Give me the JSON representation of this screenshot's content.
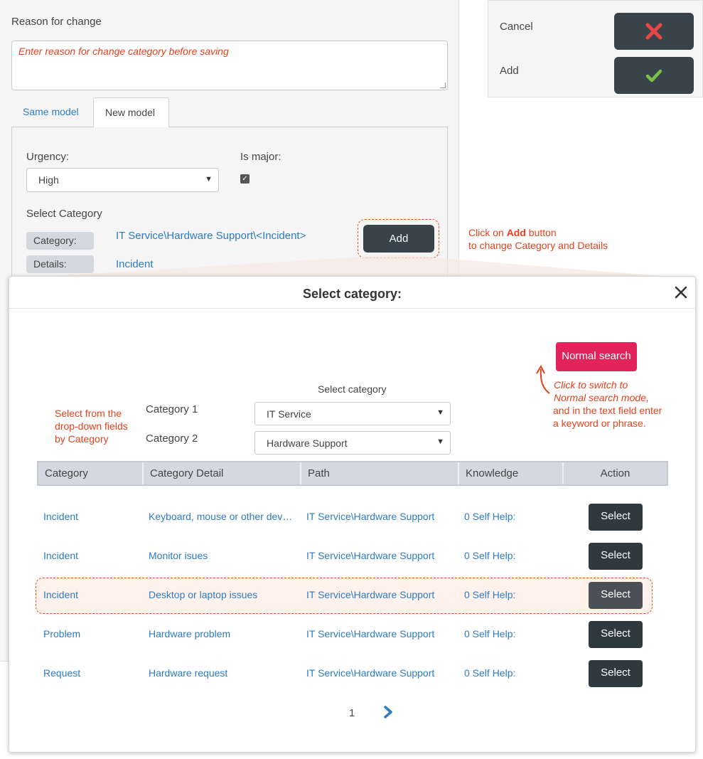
{
  "form": {
    "reason_label": "Reason for change",
    "reason_placeholder": "Enter reason for change category before saving",
    "tabs": [
      "Same model",
      "New model"
    ],
    "urgency_label": "Urgency:",
    "urgency_value": "High",
    "is_major_label": "Is major:",
    "is_major_checked": true,
    "select_category_label": "Select Category",
    "category_label": "Category:",
    "category_value": "IT Service\\Hardware Support\\<Incident>",
    "details_label": "Details:",
    "details_value": "Incident",
    "add_button": "Add"
  },
  "actions": {
    "cancel_label": "Cancel",
    "add_label": "Add",
    "cancel_icon": "x-icon",
    "add_icon": "checkmark-icon"
  },
  "annotations": {
    "add_hint_prefix": "Click on ",
    "add_hint_bold": "Add",
    "add_hint_suffix": " button",
    "add_hint_line2": "to change Category and Details",
    "dropdown_hint": [
      "Select from the",
      "drop-down fields",
      "by Category"
    ],
    "search_hint_italic": [
      "Click to switch to",
      "Normal search mode,"
    ],
    "search_hint_plain": [
      "and in the text field enter",
      "a keyword or phrase."
    ]
  },
  "modal": {
    "title": "Select category:",
    "normal_search_button": "Normal search",
    "select_category_heading": "Select category",
    "category1_label": "Category 1",
    "category1_value": "IT Service",
    "category2_label": "Category 2",
    "category2_value": "Hardware Support",
    "columns": [
      "Category",
      "Category Detail",
      "Path",
      "Knowledge",
      "Action"
    ],
    "rows": [
      {
        "category": "Incident",
        "detail": "Keyboard, mouse or other devices issues",
        "path": "IT Service\\Hardware Support",
        "knowledge": "0 Self Help:",
        "action": "Select"
      },
      {
        "category": "Incident",
        "detail": "Monitor isues",
        "path": "IT Service\\Hardware Support",
        "knowledge": "0 Self Help:",
        "action": "Select"
      },
      {
        "category": "Incident",
        "detail": "Desktop or laptop issues",
        "path": "IT Service\\Hardware Support",
        "knowledge": "0 Self Help:",
        "action": "Select"
      },
      {
        "category": "Problem",
        "detail": "Hardware problem",
        "path": "IT Service\\Hardware Support",
        "knowledge": "0 Self Help:",
        "action": "Select"
      },
      {
        "category": "Request",
        "detail": "Hardware request",
        "path": "IT Service\\Hardware Support",
        "knowledge": "0 Self Help:",
        "action": "Select"
      }
    ],
    "page_number": "1",
    "close_icon": "close-icon",
    "next_icon": "chevron-right-icon"
  },
  "colors": {
    "accent_link": "#2e7bbf",
    "dark_button": "#39434a",
    "normal_search": "#e2245a",
    "annotation": "#e8401c",
    "cancel_x": "#e84545",
    "add_check": "#7bc043"
  }
}
